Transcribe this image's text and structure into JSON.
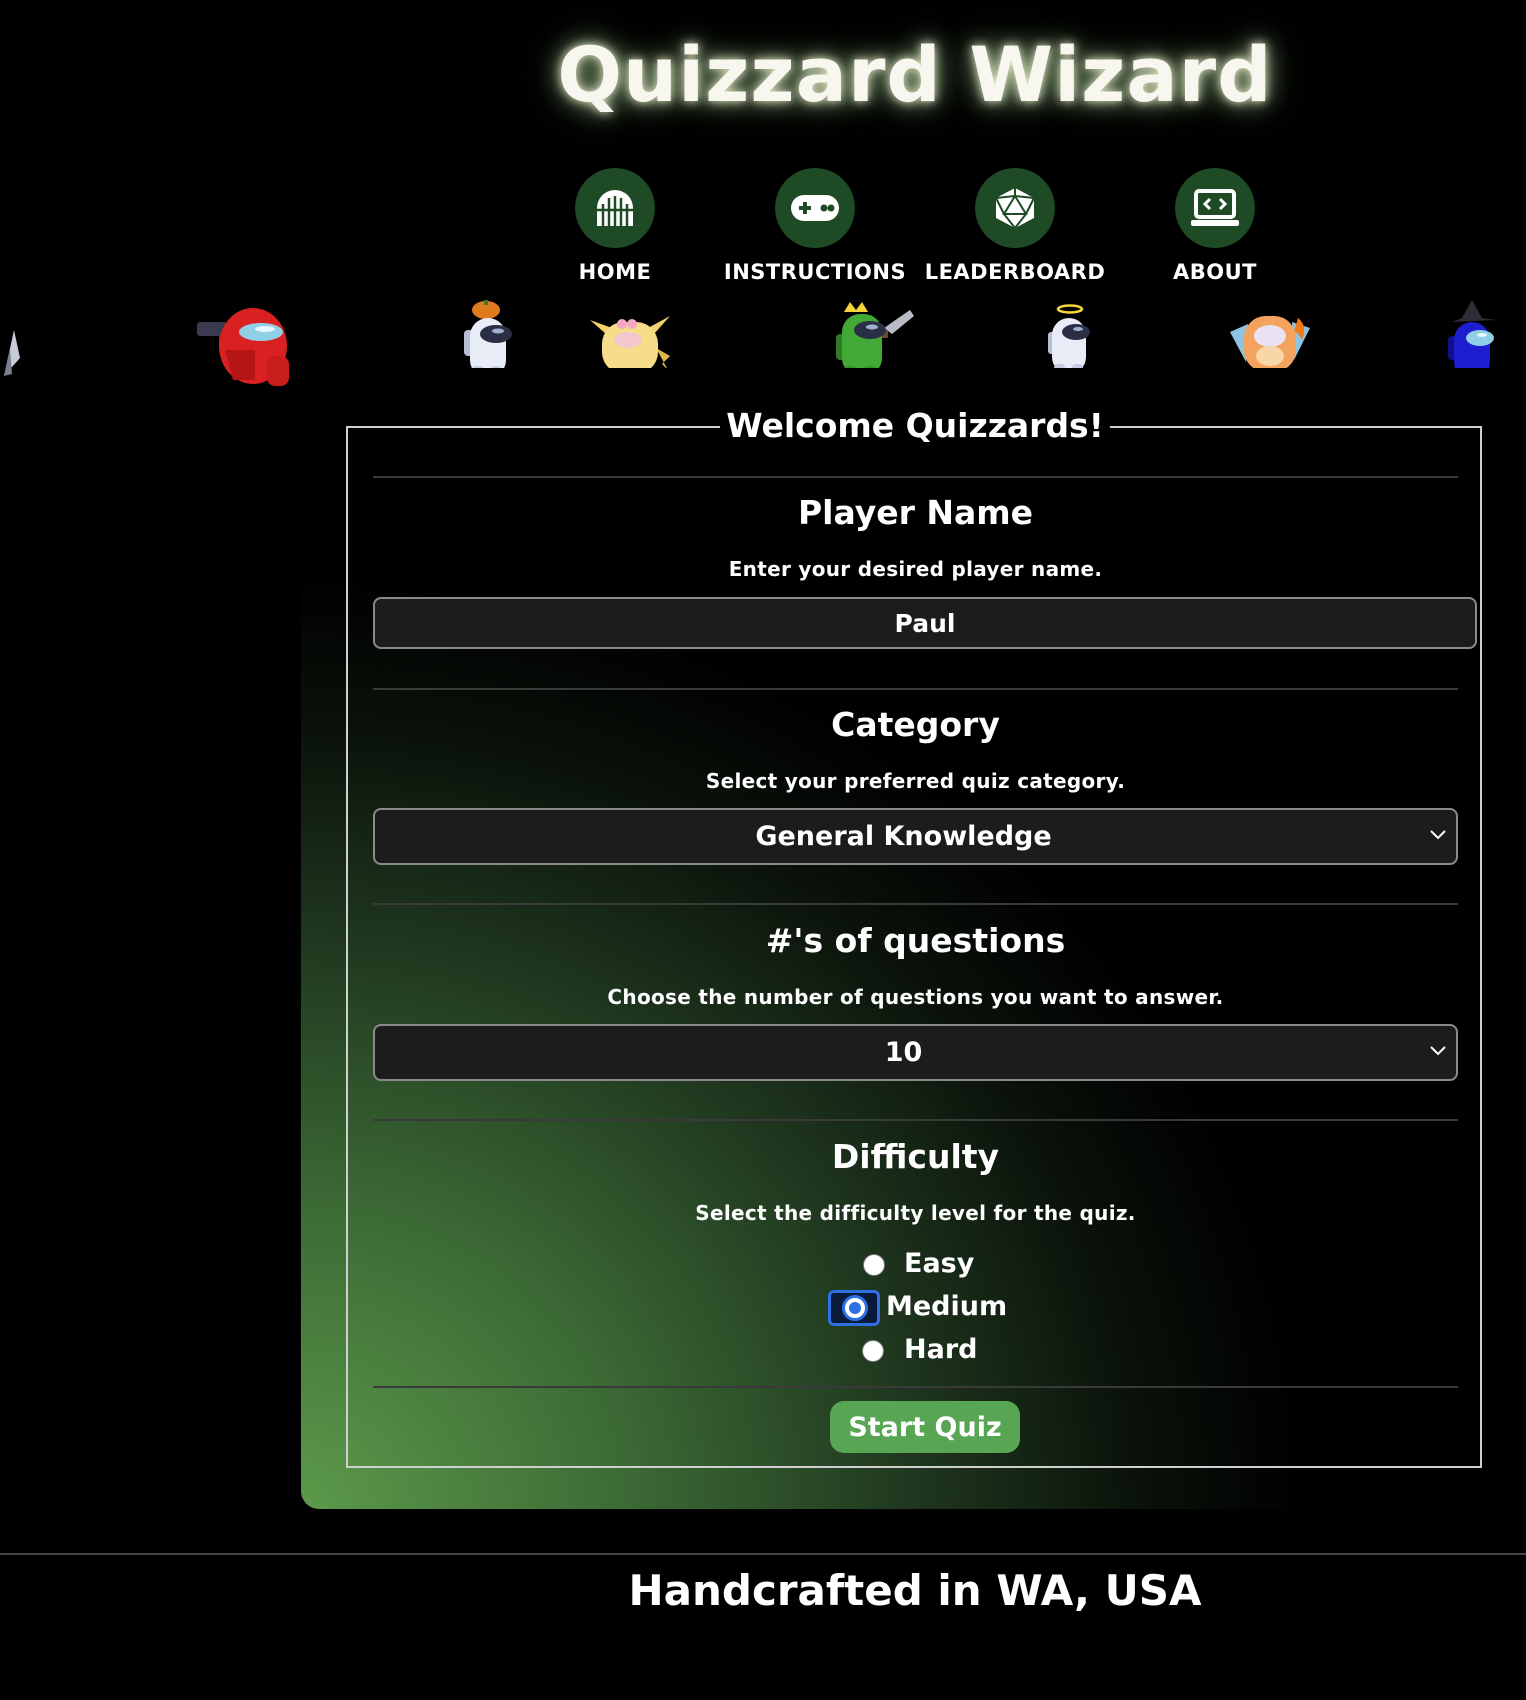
{
  "site": {
    "title": "Quizzard Wizard",
    "accent_color": "#58a653",
    "nav_circle_color": "#1e4a25"
  },
  "nav": {
    "items": [
      {
        "label": "HOME",
        "icon": "arch-door-icon"
      },
      {
        "label": "INSTRUCTIONS",
        "icon": "gamepad-icon"
      },
      {
        "label": "LEADERBOARD",
        "icon": "d20-dice-icon"
      },
      {
        "label": "ABOUT",
        "icon": "laptop-code-icon"
      }
    ]
  },
  "sprites": [
    "knife-crewmate-sprite",
    "red-crewmate-gun-sprite",
    "white-crewmate-pumpkin-hat-sprite",
    "pikachu-crewmate-sprite",
    "green-crewmate-crown-sprite",
    "white-crewmate-halo-sprite",
    "charizard-crewmate-sprite",
    "blue-crewmate-witch-hat-sprite"
  ],
  "form": {
    "legend": "Welcome Quizzards!",
    "player_name": {
      "title": "Player Name",
      "description": "Enter your desired player name.",
      "value": "Paul"
    },
    "category": {
      "title": "Category",
      "description": "Select your preferred quiz category.",
      "selected": "General Knowledge"
    },
    "questions": {
      "title": "#'s of questions",
      "description": "Choose the number of questions you want to answer.",
      "selected": "10"
    },
    "difficulty": {
      "title": "Difficulty",
      "description": "Select the difficulty level for the quiz.",
      "options": [
        {
          "label": "Easy",
          "checked": false
        },
        {
          "label": "Medium",
          "checked": true
        },
        {
          "label": "Hard",
          "checked": false
        }
      ]
    },
    "submit_label": "Start Quiz"
  },
  "footer": {
    "text": "Handcrafted in WA, USA"
  }
}
